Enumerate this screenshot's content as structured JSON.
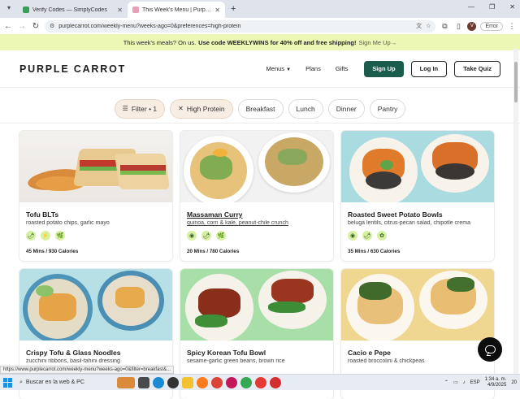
{
  "browser": {
    "tabs": [
      {
        "title": "Verify Codes — SimplyCodes",
        "active": false,
        "favicon_color": "#3a9c5a"
      },
      {
        "title": "This Week's Menu | Purple Carrot",
        "active": true,
        "favicon_color": "#e8a0b8"
      }
    ],
    "new_tab": "+",
    "url": "purplecarrot.com/weekly-menu?weeks-ago=0&preferences=high-protein",
    "error_label": "Error",
    "avatar_letter": "V",
    "controls": {
      "minimize": "—",
      "restore": "❐",
      "close": "✕"
    }
  },
  "promo": {
    "lead": "This week's meals? On us.",
    "offer": "Use code WEEKLYWINS for 40% off and free shipping!",
    "link": "Sign Me Up→"
  },
  "header": {
    "logo": "PURPLE CARROT",
    "nav": [
      "Menus",
      "Plans",
      "Gifts"
    ],
    "buttons": {
      "signup": "Sign Up",
      "login": "Log In",
      "quiz": "Take Quiz"
    }
  },
  "filters": {
    "filter_label": "Filter • 1",
    "active_chip": "High Protein",
    "chips": [
      "Breakfast",
      "Lunch",
      "Dinner",
      "Pantry"
    ]
  },
  "meals": [
    {
      "name": "Tofu BLTs",
      "sub": "roasted potato chips, garlic mayo",
      "info": "45 Mins / 930 Calories",
      "underline": false,
      "icons": [
        "🌶",
        "⚡",
        "🌿"
      ]
    },
    {
      "name": "Massaman Curry",
      "sub": "quinoa, corn & kale, peanut-chile crunch",
      "info": "20 Mins / 780 Calories",
      "underline": true,
      "icons": [
        "◉",
        "🌶",
        "🌿"
      ]
    },
    {
      "name": "Roasted Sweet Potato Bowls",
      "sub": "beluga lentils, citrus-pecan salad, chipotle crema",
      "info": "35 Mins / 630 Calories",
      "underline": false,
      "icons": [
        "◉",
        "🌶",
        "✿"
      ]
    },
    {
      "name": "Crispy Tofu & Glass Noodles",
      "sub": "zucchini ribbons, basil-tahini dressing",
      "info": "",
      "underline": false,
      "icons": []
    },
    {
      "name": "Spicy Korean Tofu Bowl",
      "sub": "sesame-garlic green beans, brown rice",
      "info": "",
      "underline": false,
      "icons": []
    },
    {
      "name": "Cacio e Pepe",
      "sub": "roasted broccolini & chickpeas",
      "info": "",
      "underline": false,
      "icons": []
    }
  ],
  "status_url": "https://www.purplecarrot.com/weekly-menu?weeks-ago=0&filter=breakfast&...",
  "taskbar": {
    "search_placeholder": "Buscar en la web & PC",
    "lang": "ESP",
    "time": "1:34 a. m.",
    "date": "4/9/2025",
    "notif": "20"
  }
}
